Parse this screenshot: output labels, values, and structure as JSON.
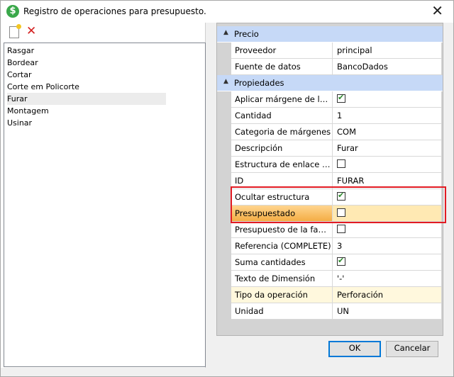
{
  "window": {
    "title": "Registro de operaciones para presupuesto."
  },
  "operations": [
    "Rasgar",
    "Bordear",
    "Cortar",
    "Corte em Policorte",
    "Furar",
    "Montagem",
    "Usinar"
  ],
  "selected_operation": "Furar",
  "properties": {
    "categories": [
      {
        "name": "Precio",
        "rows": [
          {
            "key": "Proveedor",
            "value": "principal"
          },
          {
            "key": "Fuente de datos",
            "value": "BancoDados"
          }
        ]
      },
      {
        "name": "Propiedades",
        "rows": [
          {
            "key": "Aplicar márgene de lo pai",
            "checkbox": true
          },
          {
            "key": "Cantidad",
            "value": "1"
          },
          {
            "key": "Categoria de márgenes",
            "value": "COM"
          },
          {
            "key": "Descripción",
            "value": "Furar"
          },
          {
            "key": "Estructura de enlace a la p...",
            "checkbox": false
          },
          {
            "key": "ID",
            "value": "FURAR"
          },
          {
            "key": "Ocultar estructura",
            "checkbox": true
          },
          {
            "key": "Presupuestado",
            "checkbox": false
          },
          {
            "key": "Presupuesto de la familia...",
            "checkbox": false
          },
          {
            "key": "Referencia (COMPLETE)",
            "value": "3"
          },
          {
            "key": "Suma cantidades",
            "checkbox": true
          },
          {
            "key": "Texto de Dimensión",
            "value": "'-'"
          },
          {
            "key": "Tipo da operación",
            "value": "Perforación"
          },
          {
            "key": "Unidad",
            "value": "UN"
          }
        ]
      }
    ]
  },
  "buttons": {
    "ok": "OK",
    "cancel": "Cancelar"
  }
}
